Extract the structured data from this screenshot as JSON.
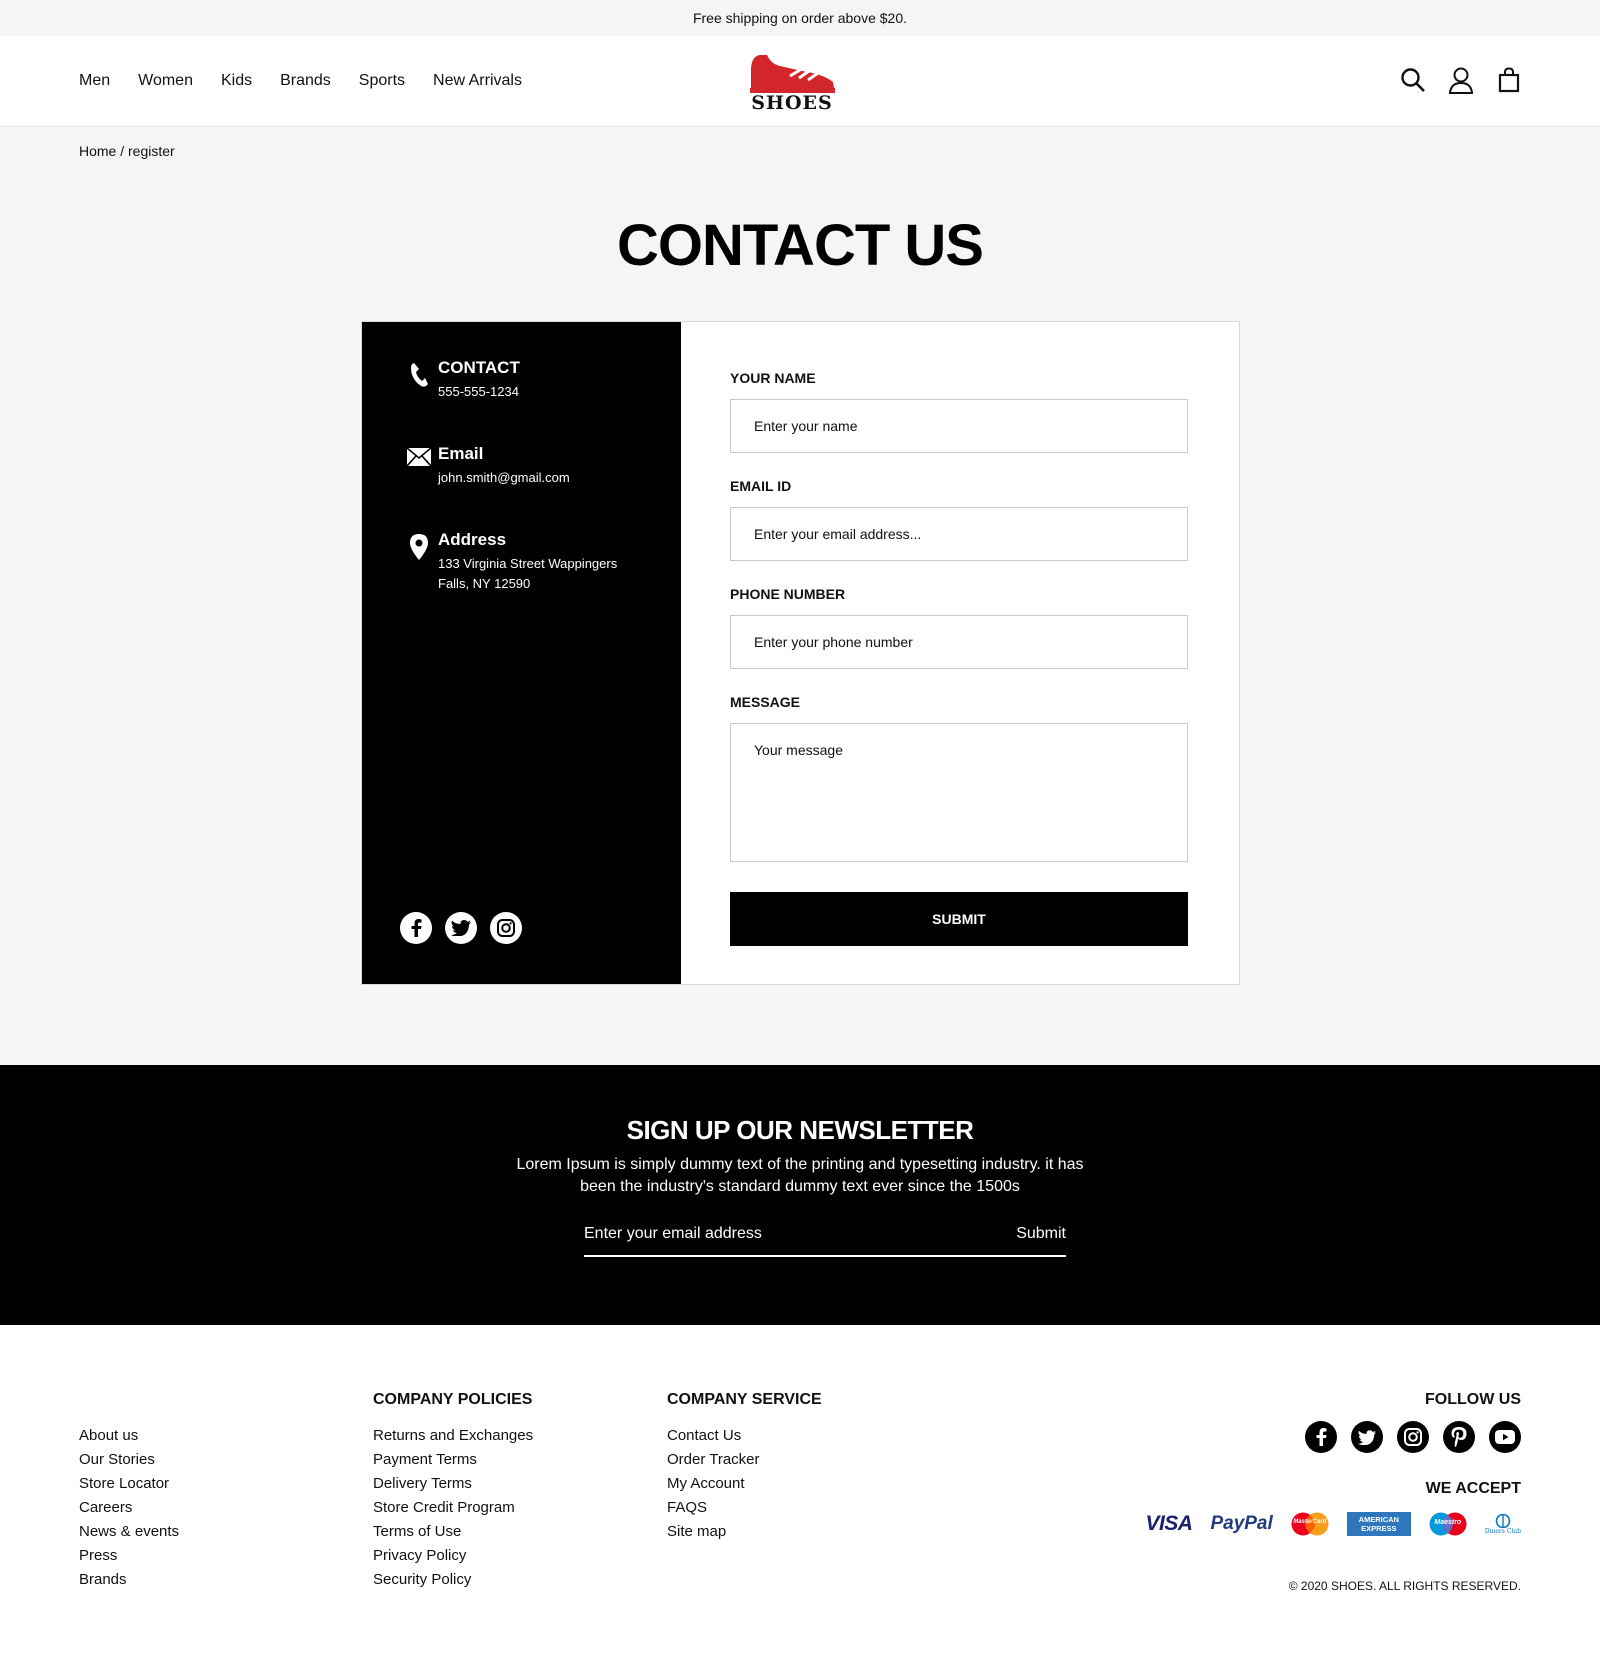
{
  "announcement": "Free shipping on order above $20.",
  "nav": [
    "Men",
    "Women",
    "Kids",
    "Brands",
    "Sports",
    "New Arrivals"
  ],
  "logo_text": "SHOES",
  "colors": {
    "brand_red": "#d2262b",
    "black": "#000000",
    "bg_gray": "#f4f5f7"
  },
  "header_icons": [
    "search-icon",
    "user-icon",
    "bag-icon"
  ],
  "breadcrumb": "Home / register",
  "page_title": "CONTACT US",
  "contact_info": {
    "phone_title": "CONTACT",
    "phone": "555-555-1234",
    "email_title": "Email",
    "email": "john.smith@gmail.com",
    "address_title": "Address",
    "address_line1": "133 Virginia Street Wappingers",
    "address_line2": "Falls, NY 12590"
  },
  "form": {
    "name_label": "YOUR NAME",
    "name_placeholder": "Enter your name",
    "email_label": "EMAIL ID",
    "email_placeholder": "Enter your email address...",
    "phone_label": "PHONE NUMBER",
    "phone_placeholder": "Enter your phone number",
    "message_label": "MESSAGE",
    "message_placeholder": "Your message",
    "submit_label": "SUBMIT"
  },
  "newsletter": {
    "title": "SIGN UP OUR NEWSLETTER",
    "text": "Lorem Ipsum is simply dummy text of the printing and typesetting industry. it has been the industry's standard dummy text ever since the 1500s",
    "placeholder": "Enter your email address",
    "submit_label": "Submit"
  },
  "footer": {
    "links_col1": [
      "About us",
      "Our Stories",
      "Store Locator",
      "Careers",
      "News & events",
      "Press",
      "Brands"
    ],
    "policies_title": "COMPANY POLICIES",
    "policies": [
      "Returns and Exchanges",
      "Payment Terms",
      "Delivery Terms",
      "Store Credit Program",
      "Terms of Use",
      "Privacy Policy",
      "Security Policy"
    ],
    "service_title": "COMPANY SERVICE",
    "service": [
      "Contact Us",
      "Order Tracker",
      "My Account",
      "FAQS",
      "Site map"
    ],
    "follow_title": "FOLLOW US",
    "accept_title": "WE ACCEPT",
    "payment_methods": [
      "VISA",
      "PayPal",
      "MasterCard",
      "AMERICAN EXPRESS",
      "Maestro",
      "Diners Club"
    ],
    "copyright": "© 2020 SHOES. ALL RIGHTS RESERVED."
  }
}
